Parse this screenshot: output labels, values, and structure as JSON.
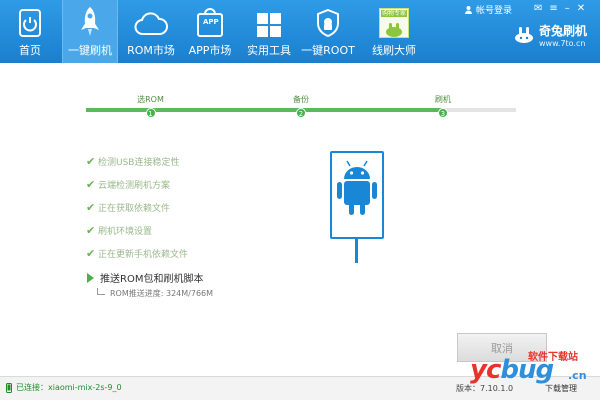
{
  "nav": {
    "items": [
      {
        "label": "首页",
        "icon": "home-icon"
      },
      {
        "label": "一键刷机",
        "icon": "rocket-icon",
        "active": true
      },
      {
        "label": "ROM市场",
        "icon": "cloud-icon"
      },
      {
        "label": "APP市场",
        "icon": "app-bag-icon",
        "badge": "APP"
      },
      {
        "label": "实用工具",
        "icon": "grid-icon"
      },
      {
        "label": "一键ROOT",
        "icon": "shield-icon"
      },
      {
        "label": "线刷大师",
        "icon": "rabbit-icon",
        "badge": "购物专家"
      }
    ]
  },
  "header": {
    "account_label": "帐号登录",
    "brand_name": "奇兔刷机",
    "brand_url": "www.7to.cn"
  },
  "progress": {
    "steps": [
      {
        "label": "选ROM",
        "number": "1",
        "position": 0.15
      },
      {
        "label": "备份",
        "number": "2",
        "position": 0.5
      },
      {
        "label": "刷机",
        "number": "3",
        "position": 0.83
      }
    ],
    "fill_fraction": 0.83
  },
  "checklist": {
    "done_items": [
      "检测USB连接稳定性",
      "云端检测刷机方案",
      "正在获取依赖文件",
      "刷机环境设置",
      "正在更新手机依赖文件"
    ],
    "current_item": "推送ROM包和刷机脚本",
    "sub_status": "ROM推送进度: 324M/766M"
  },
  "buttons": {
    "cancel": "取消"
  },
  "status": {
    "connection": "已连接：xiaomi-mix-2s-9_0",
    "version": "版本：7.10.1.0",
    "download_manager": "下载管理"
  },
  "watermark": {
    "logo_part1": "yc",
    "logo_part2": "bug",
    "site_name": "软件下载站",
    "suffix": ".cn"
  },
  "colors": {
    "toolbar": "#1f88d8",
    "accent_green": "#4cae4c",
    "phone_blue": "#1a86d6",
    "android_green": "#9bc53d"
  }
}
